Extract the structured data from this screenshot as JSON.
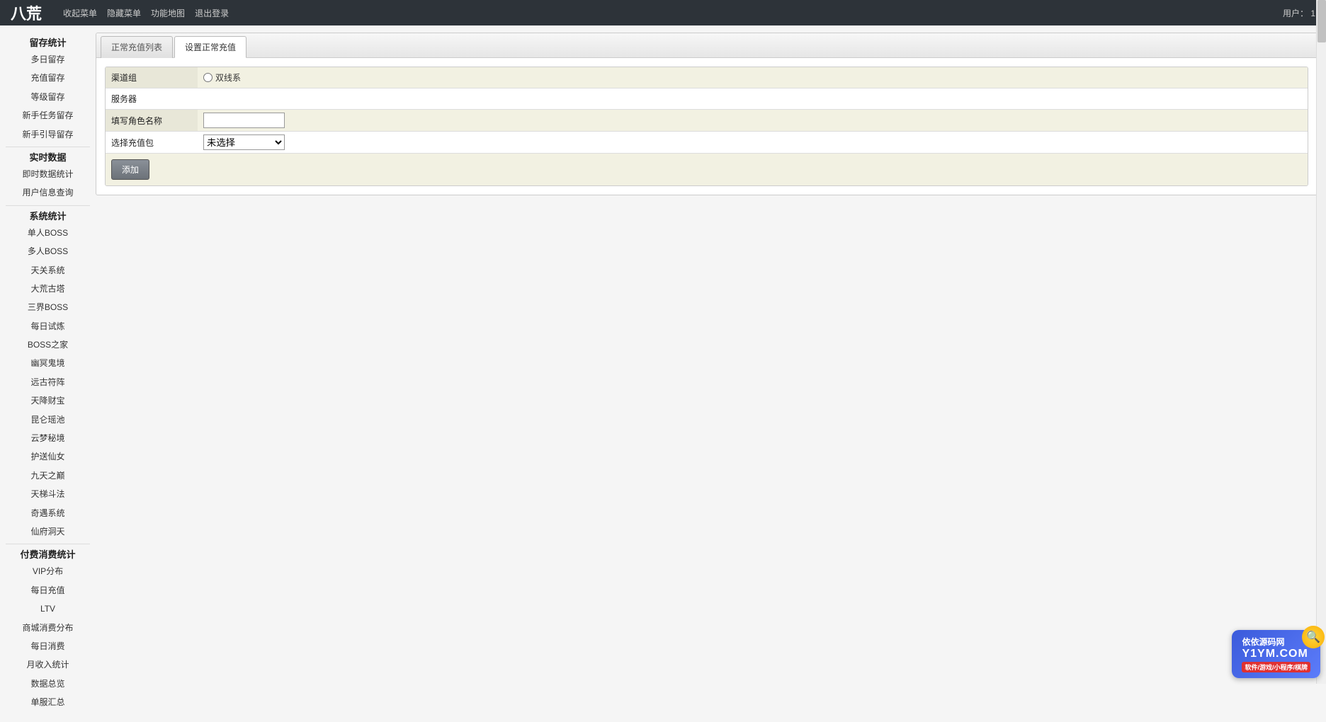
{
  "topbar": {
    "brand": "八荒",
    "links": [
      "收起菜单",
      "隐藏菜单",
      "功能地图",
      "退出登录"
    ],
    "user_label": "用户：",
    "user_value": "1"
  },
  "sidebar": [
    {
      "title": "留存统计",
      "items": [
        "多日留存",
        "充值留存",
        "等级留存",
        "新手任务留存",
        "新手引导留存"
      ]
    },
    {
      "title": "实时数据",
      "items": [
        "即时数据统计",
        "用户信息查询"
      ]
    },
    {
      "title": "系统统计",
      "items": [
        "单人BOSS",
        "多人BOSS",
        "天关系统",
        "大荒古塔",
        "三界BOSS",
        "每日试炼",
        "BOSS之家",
        "幽冥鬼境",
        "远古符阵",
        "天降财宝",
        "昆仑瑶池",
        "云梦秘境",
        "护送仙女",
        "九天之巅",
        "天梯斗法",
        "奇遇系统",
        "仙府洞天"
      ]
    },
    {
      "title": "付费消费统计",
      "items": [
        "VIP分布",
        "每日充值",
        "LTV",
        "商城消费分布",
        "每日消费",
        "月收入统计",
        "数据总览",
        "单服汇总"
      ]
    }
  ],
  "tabs": {
    "list": [
      "正常充值列表",
      "设置正常充值"
    ],
    "active_index": 1
  },
  "form": {
    "row_channel_group": {
      "label": "渠道组",
      "radio_option": "双线系"
    },
    "row_server": {
      "label": "服务器"
    },
    "row_role": {
      "label": "填写角色名称",
      "value": ""
    },
    "row_package": {
      "label": "选择充值包",
      "options": [
        "未选择"
      ],
      "selected": "未选择"
    },
    "submit_label": "添加"
  },
  "watermark": {
    "top": "依依源码网",
    "mid": "Y1YM.COM",
    "bot": "软件/游戏/小程序/棋牌"
  }
}
